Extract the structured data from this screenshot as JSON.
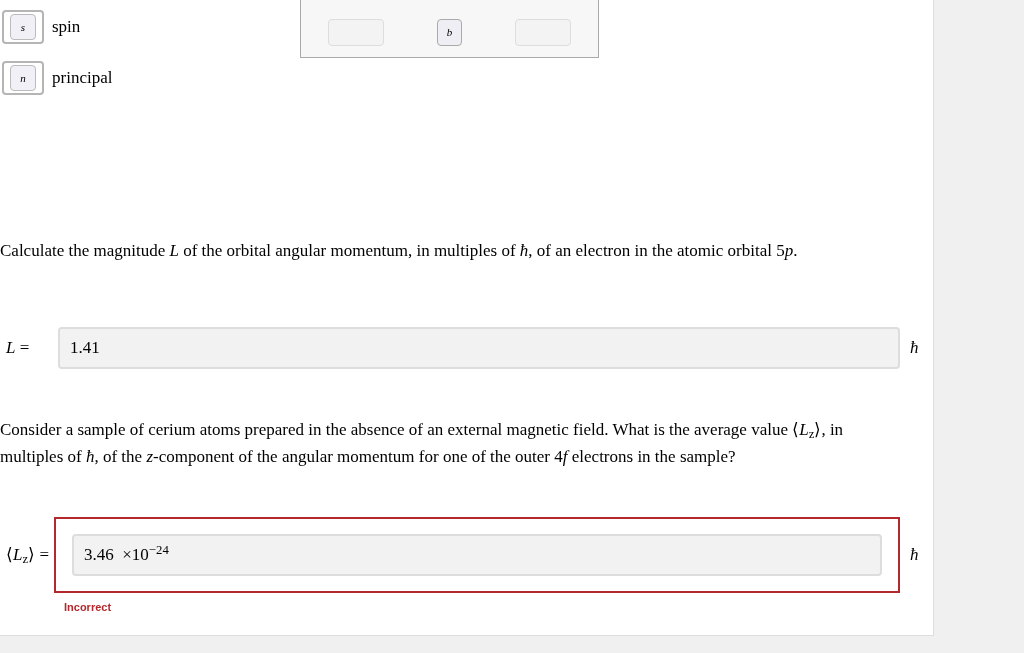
{
  "tiles": [
    {
      "symbol": "s",
      "label": "spin"
    },
    {
      "symbol": "n",
      "label": "principal"
    }
  ],
  "palette": {
    "slots": [
      {
        "kind": "empty"
      },
      {
        "kind": "tile",
        "text": "b"
      },
      {
        "kind": "empty"
      }
    ]
  },
  "questions": [
    {
      "prompt": [
        "Calculate the magnitude *L* of the orbital angular momentum, in multiples of *ħ*, of an electron in the atomic orbital 5",
        "*p*."
      ],
      "label": "*L* =",
      "value": "1.41",
      "unit": "ħ",
      "incorrect": false
    },
    {
      "prompt": [
        "Consider a sample of cerium atoms prepared in the absence of an external magnetic field. What is the average value ⟨*L*$_{z}$⟩, in multiples of *ħ*, of the *z*-component of the angular momentum for one of the outer 4",
        "*f* electrons in the sample?"
      ],
      "label": "⟨*L*$_{z}$⟩ =",
      "value": "3.46  ×10$^{−24}$",
      "unit": "ħ",
      "incorrect": true,
      "feedback": "Incorrect"
    }
  ]
}
